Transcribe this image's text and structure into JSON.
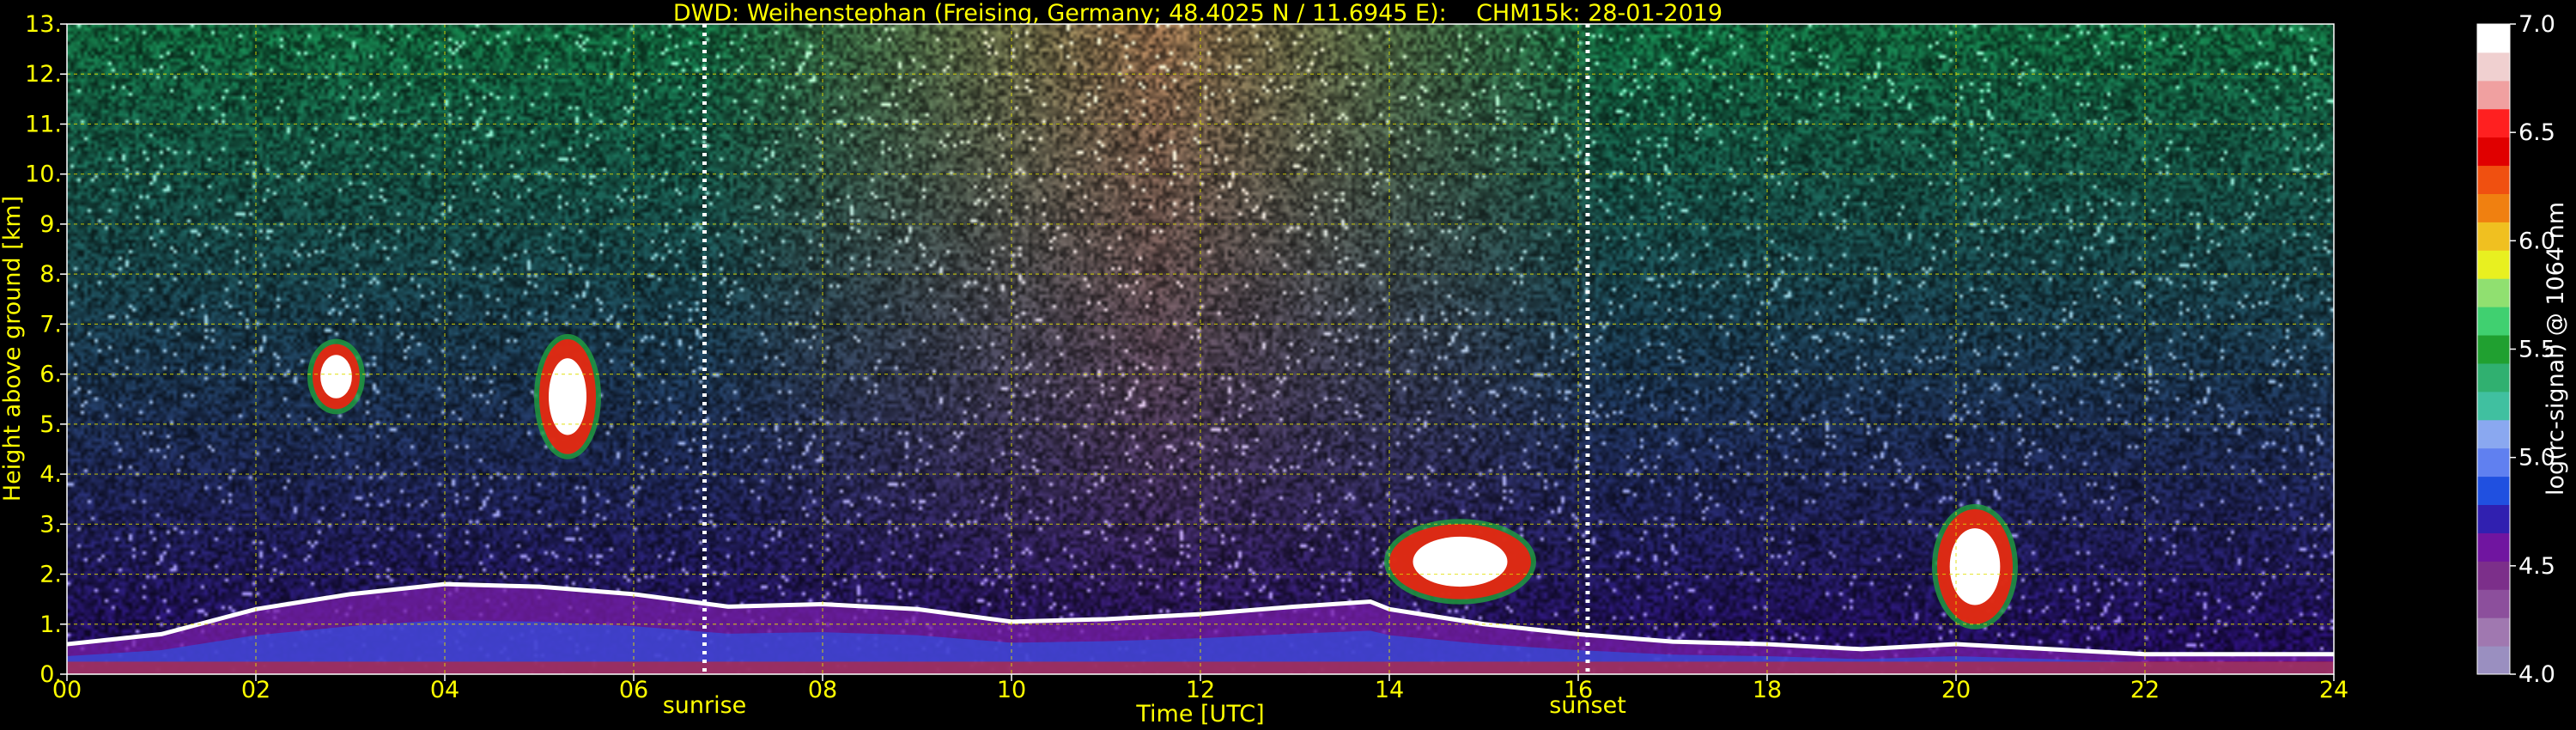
{
  "chart_data": {
    "type": "heatmap",
    "title": "DWD: Weihenstephan (Freising, Germany; 48.4025 N / 11.6945 E):    CHM15k: 28-01-2019",
    "xlabel": "Time [UTC]",
    "ylabel": "Height above ground [km]",
    "xlim": [
      0,
      24
    ],
    "ylim": [
      0,
      13
    ],
    "x_ticks": [
      0,
      2,
      4,
      6,
      8,
      10,
      12,
      14,
      16,
      18,
      20,
      22,
      24
    ],
    "x_tick_labels": [
      "00",
      "02",
      "04",
      "06",
      "08",
      "10",
      "12",
      "14",
      "16",
      "18",
      "20",
      "22",
      "24"
    ],
    "y_ticks": [
      0,
      1,
      2,
      3,
      4,
      5,
      6,
      7,
      8,
      9,
      10,
      11,
      12,
      13
    ],
    "y_tick_labels": [
      "0.",
      "1.",
      "2.",
      "3.",
      "4.",
      "5.",
      "6.",
      "7.",
      "8.",
      "9.",
      "10.",
      "11.",
      "12.",
      "13."
    ],
    "grid": true,
    "colorbar": {
      "label": "log(rc-signal) @ 1064 nm",
      "range": [
        4.0,
        7.0
      ],
      "ticks": [
        4.0,
        4.5,
        5.0,
        5.5,
        6.0,
        6.5,
        7.0
      ],
      "tick_labels": [
        "4.0",
        "4.5",
        "5.0",
        "5.5",
        "6.0",
        "6.5",
        "7.0"
      ],
      "colors": [
        "#9a8fc0",
        "#a078b0",
        "#8c4f9c",
        "#7c2f8a",
        "#7015a0",
        "#3020b0",
        "#2050e0",
        "#6080f0",
        "#8aa8f0",
        "#40c0a0",
        "#30b070",
        "#20a030",
        "#40d070",
        "#90e070",
        "#e8f020",
        "#f0c020",
        "#f08010",
        "#f05010",
        "#e00000",
        "#ff2020",
        "#f0a0a0",
        "#f0d0d0",
        "#ffffff"
      ]
    },
    "annotations": [
      {
        "label": "sunrise",
        "x": 6.75
      },
      {
        "label": "sunset",
        "x": 16.1
      }
    ],
    "features": [
      {
        "name": "boundary layer top",
        "x": [
          0,
          1,
          2,
          3,
          4,
          5,
          6,
          7,
          8,
          9,
          10,
          11,
          12,
          13,
          13.8,
          14,
          15,
          16,
          17,
          18,
          19,
          20,
          21,
          22,
          23,
          24
        ],
        "y": [
          0.6,
          0.8,
          1.3,
          1.6,
          1.8,
          1.75,
          1.6,
          1.35,
          1.4,
          1.3,
          1.05,
          1.1,
          1.2,
          1.35,
          1.45,
          1.3,
          1.0,
          0.8,
          0.65,
          0.6,
          0.5,
          0.6,
          0.5,
          0.4,
          0.4,
          0.4
        ]
      },
      {
        "name": "cloud patch 02-03 UTC",
        "x_range": [
          2.6,
          3.1
        ],
        "y_range": [
          5.3,
          6.6
        ]
      },
      {
        "name": "cloud patch 05 UTC",
        "x_range": [
          5.0,
          5.6
        ],
        "y_range": [
          4.4,
          6.7
        ]
      },
      {
        "name": "convective plumes 14-15.5 UTC",
        "x_range": [
          14.0,
          15.5
        ],
        "y_range": [
          1.5,
          3.0
        ]
      },
      {
        "name": "plume 20 UTC",
        "x_range": [
          19.8,
          20.6
        ],
        "y_range": [
          1.0,
          3.3
        ]
      }
    ]
  }
}
